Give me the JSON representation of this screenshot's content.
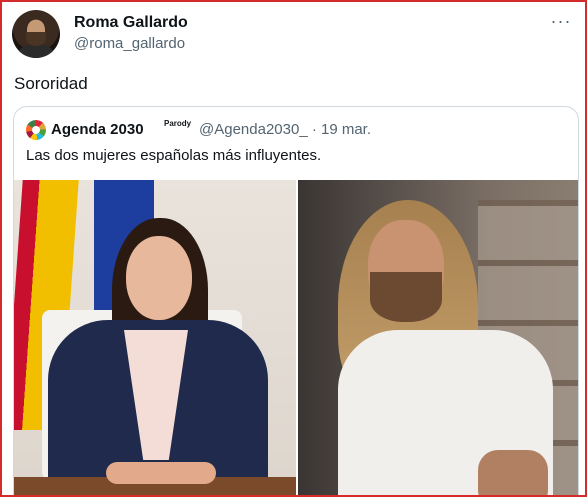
{
  "tweet": {
    "author_name": "Roma Gallardo",
    "author_handle": "@roma_gallardo",
    "more_icon": "···",
    "text": "Sororidad"
  },
  "quoted_tweet": {
    "author_name": "Agenda 2030",
    "badge": "Parody",
    "handle_date": "@Agenda2030_ · 19 mar.",
    "text": "Las dos mujeres españolas más influyentes."
  },
  "colors": {
    "frame_border": "#d62b2b",
    "muted_text": "#536471",
    "card_border": "#cfd9de"
  }
}
